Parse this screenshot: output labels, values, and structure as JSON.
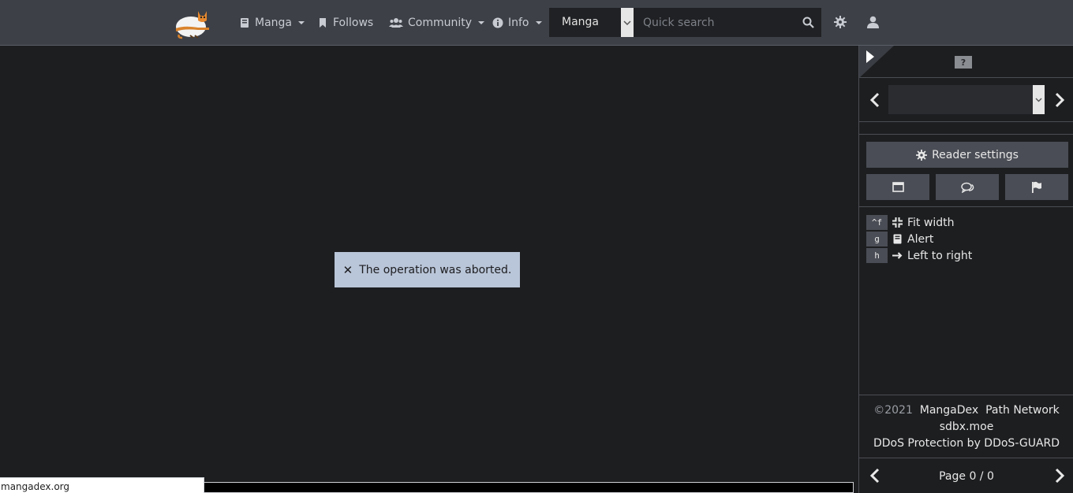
{
  "navbar": {
    "logo_icon": "mangadex-cat-logo-icon",
    "items": [
      {
        "label": "Manga",
        "icon": "book-icon",
        "dropdown": true
      },
      {
        "label": "Follows",
        "icon": "bookmark-icon",
        "dropdown": false
      },
      {
        "label": "Community",
        "icon": "users-icon",
        "dropdown": true
      },
      {
        "label": "Info",
        "icon": "info-circle-icon",
        "dropdown": true
      }
    ],
    "search": {
      "type_value": "Manga",
      "placeholder": "Quick search"
    }
  },
  "alert": {
    "message": "The operation was aborted."
  },
  "status_bar": {
    "url": "mangadex.org"
  },
  "sidebar": {
    "help_label": "?",
    "reader_settings_label": "Reader settings",
    "shortcuts": [
      {
        "key": "^f",
        "icon": "compress-icon",
        "label": "Fit width"
      },
      {
        "key": "g",
        "icon": "book-icon",
        "label": "Alert"
      },
      {
        "key": "h",
        "icon": "arrow-right-icon",
        "label": "Left to right"
      }
    ],
    "footer": {
      "copyright": "©2021",
      "brand": "MangaDex",
      "network": "Path Network",
      "host": "sdbx.moe",
      "ddos": "DDoS Protection by DDoS-GUARD"
    },
    "page_label": "Page 0 / 0"
  },
  "colors": {
    "navbar_bg": "#3d4047",
    "page_bg": "#1d1e20",
    "alert_bg": "#b9c5d8",
    "button_bg": "#4a4d55"
  }
}
